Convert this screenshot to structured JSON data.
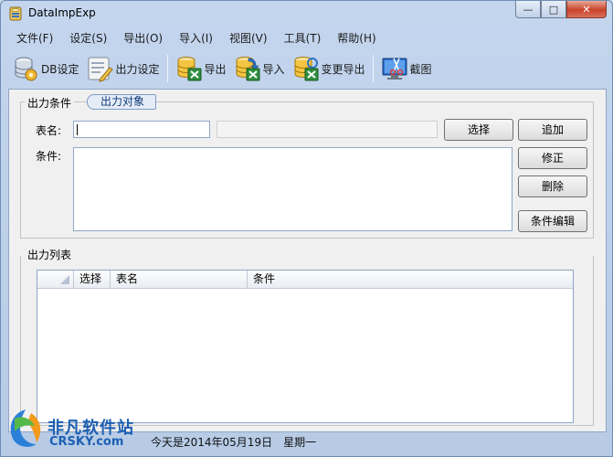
{
  "window": {
    "title": "DataImpExp",
    "minimize_glyph": "—",
    "maximize_glyph": "□",
    "close_glyph": "✕"
  },
  "menu": [
    {
      "label": "文件(F)"
    },
    {
      "label": "设定(S)"
    },
    {
      "label": "导出(O)"
    },
    {
      "label": "导入(I)"
    },
    {
      "label": "视图(V)"
    },
    {
      "label": "工具(T)"
    },
    {
      "label": "帮助(H)"
    }
  ],
  "toolbar": {
    "db_setting": "DB设定",
    "output_setting": "出力设定",
    "export": "导出",
    "import": "导入",
    "change_export": "变更导出",
    "screenshot": "截图"
  },
  "condition_panel": {
    "title": "出力条件",
    "tab": "出力对象",
    "table_name_label": "表名:",
    "table_name_value": "",
    "condition_label": "条件:",
    "condition_value": "",
    "select_button": "选择",
    "add_button": "追加",
    "modify_button": "修正",
    "delete_button": "删除",
    "edit_condition_button": "条件编辑"
  },
  "output_list": {
    "title": "出力列表",
    "columns": [
      "选择",
      "表名",
      "条件"
    ]
  },
  "statusbar": {
    "date_text": "今天是2014年05月19日",
    "weekday_text": "星期一"
  },
  "watermark": {
    "line1": "非凡软件站",
    "line2": "CRSKY.com"
  },
  "colors": {
    "accent": "#1c5fb2",
    "window_bg": "#c4d6ee",
    "panel_bg": "#f0f0f0"
  }
}
